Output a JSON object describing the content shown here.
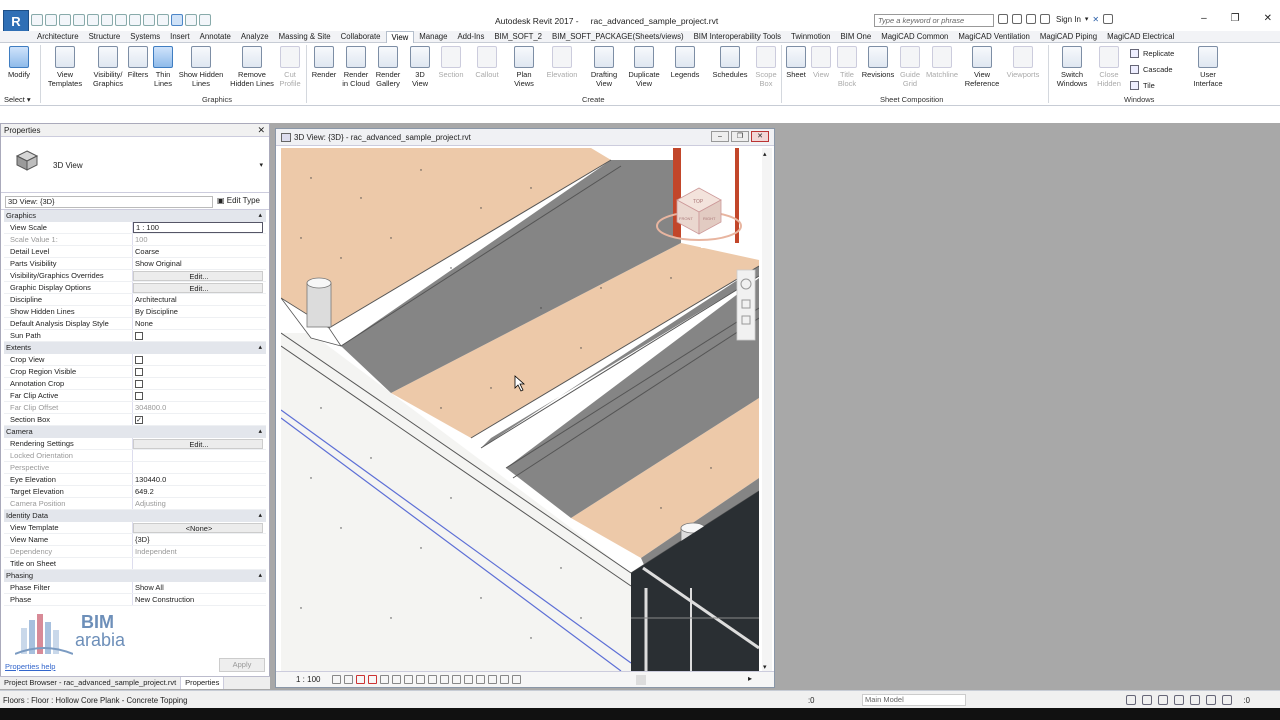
{
  "app": {
    "title": "Autodesk Revit 2017 -",
    "file": "rac_advanced_sample_project.rvt",
    "logo_letter": "R",
    "search_placeholder": "Type a keyword or phrase",
    "sign_in": "Sign In",
    "window_controls": [
      "–",
      "❐",
      "✕"
    ]
  },
  "tabs": [
    "Architecture",
    "Structure",
    "Systems",
    "Insert",
    "Annotate",
    "Analyze",
    "Massing & Site",
    "Collaborate",
    "View",
    "Manage",
    "Add-Ins",
    "BIM_SOFT_2",
    "BIM_SOFT_PACKAGE(Sheets/views)",
    "BIM Interoperability Tools",
    "Twinmotion",
    "BIM One",
    "MagiCAD Common",
    "MagiCAD Ventilation",
    "MagiCAD Piping",
    "MagiCAD Electrical"
  ],
  "active_tab": "View",
  "ribbon": {
    "modify": "Modify",
    "select": "Select ▾",
    "graphics": [
      "View Templates",
      "Visibility/ Graphics",
      "Filters",
      "Thin Lines",
      "Show Hidden Lines",
      "Remove Hidden Lines",
      "Cut Profile"
    ],
    "graphics_label": "Graphics",
    "create": [
      "Render",
      "Render in Cloud",
      "Render Gallery",
      "3D View",
      "Section",
      "Callout",
      "Plan Views",
      "Elevation",
      "Drafting View",
      "Duplicate View",
      "Legends",
      "Schedules",
      "Scope Box"
    ],
    "create_label": "Create",
    "sheet": [
      "Sheet",
      "View",
      "Title Block",
      "Revisions",
      "Guide Grid",
      "Matchline",
      "View Reference",
      "Viewports"
    ],
    "sheet_label": "Sheet Composition",
    "windows": [
      "Switch Windows",
      "Close Hidden",
      "Replicate",
      "Cascade",
      "Tile",
      "User Interface"
    ],
    "windows_label": "Windows"
  },
  "properties": {
    "header": "Properties",
    "close": "✕",
    "type_name": "3D View",
    "instance": "3D View: {3D}",
    "edit_type": "Edit Type",
    "sections": [
      {
        "name": "Graphics",
        "rows": [
          {
            "k": "View Scale",
            "v": "1 : 100",
            "style": "inp"
          },
          {
            "k": "Scale Value    1:",
            "v": "100",
            "style": "dim"
          },
          {
            "k": "Detail Level",
            "v": "Coarse"
          },
          {
            "k": "Parts Visibility",
            "v": "Show Original"
          },
          {
            "k": "Visibility/Graphics Overrides",
            "v": "Edit...",
            "style": "btn"
          },
          {
            "k": "Graphic Display Options",
            "v": "Edit...",
            "style": "btn"
          },
          {
            "k": "Discipline",
            "v": "Architectural"
          },
          {
            "k": "Show Hidden Lines",
            "v": "By Discipline"
          },
          {
            "k": "Default Analysis Display Style",
            "v": "None"
          },
          {
            "k": "Sun Path",
            "v": "",
            "style": "chk"
          }
        ]
      },
      {
        "name": "Extents",
        "rows": [
          {
            "k": "Crop View",
            "v": "",
            "style": "chk"
          },
          {
            "k": "Crop Region Visible",
            "v": "",
            "style": "chk"
          },
          {
            "k": "Annotation Crop",
            "v": "",
            "style": "chk"
          },
          {
            "k": "Far Clip Active",
            "v": "",
            "style": "chk"
          },
          {
            "k": "Far Clip Offset",
            "v": "304800.0",
            "style": "dim"
          },
          {
            "k": "Section Box",
            "v": "✓",
            "style": "chk"
          }
        ]
      },
      {
        "name": "Camera",
        "rows": [
          {
            "k": "Rendering Settings",
            "v": "Edit...",
            "style": "btn"
          },
          {
            "k": "Locked Orientation",
            "v": "",
            "style": "dim"
          },
          {
            "k": "Perspective",
            "v": "",
            "style": "dim"
          },
          {
            "k": "Eye Elevation",
            "v": "130440.0"
          },
          {
            "k": "Target Elevation",
            "v": "649.2"
          },
          {
            "k": "Camera Position",
            "v": "Adjusting",
            "style": "dim"
          }
        ]
      },
      {
        "name": "Identity Data",
        "rows": [
          {
            "k": "View Template",
            "v": "<None>",
            "style": "btn"
          },
          {
            "k": "View Name",
            "v": "{3D}"
          },
          {
            "k": "Dependency",
            "v": "Independent",
            "style": "dim"
          },
          {
            "k": "Title on Sheet",
            "v": ""
          }
        ]
      },
      {
        "name": "Phasing",
        "rows": [
          {
            "k": "Phase Filter",
            "v": "Show All"
          },
          {
            "k": "Phase",
            "v": "New Construction"
          }
        ]
      }
    ],
    "help": "Properties help",
    "apply": "Apply",
    "logo_1": "BIM",
    "logo_2": "arabia",
    "tabs": [
      "Project Browser - rac_advanced_sample_project.rvt",
      "Properties"
    ]
  },
  "view": {
    "title": "3D View: {3D} - rac_advanced_sample_project.rvt",
    "scale": "1 : 100",
    "cube_labels": [
      "TOP",
      "FRONT",
      "RIGHT"
    ]
  },
  "status": {
    "text": "Floors : Floor : Hollow Core Plank - Concrete Topping",
    "zero": ":0",
    "model": "Main Model",
    "right_zero": ":0"
  },
  "colors": {
    "accent": "#2f6fb5",
    "floor_tan": "#edc9a9",
    "dark_grey": "#858585",
    "background": "#a8a8a8",
    "section_line": "#5d6fd6"
  }
}
